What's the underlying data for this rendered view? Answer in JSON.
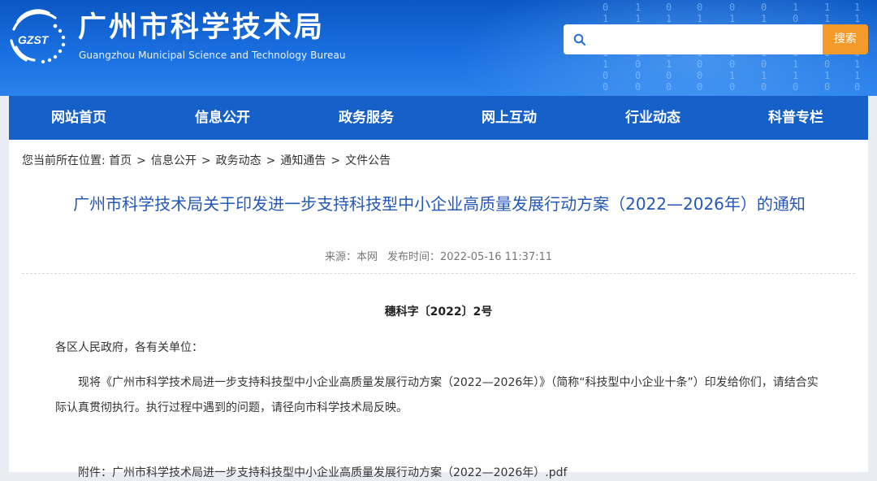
{
  "header": {
    "logo_abbr": "GZST",
    "title": "广州市科学技术局",
    "subtitle": "Guangzhou Municipal Science and Technology Bureau",
    "search": {
      "placeholder": "",
      "value": "",
      "button_label": "搜索",
      "icon": "search-icon"
    },
    "binary_columns": [
      "0\n1\n1\n1\n1\n1\n0\n0",
      "1\n1\n1\n1\n1\n0\n0\n0",
      "0\n1\n1\n1\n1\n1\n0\n0",
      "0\n1\n1\n0\n1\n0\n0\n0",
      "0\n1\n0\n1\n1\n0\n1\n0",
      "0\n1\n1\n0\n1\n0\n1\n0",
      "1\n0\n1\n1\n0\n1\n1\n0",
      "1\n1\n0\n1\n0\n0\n1\n0",
      "1\n1\n1\n0\n0\n1\n1\n0"
    ]
  },
  "nav": {
    "items": [
      {
        "label": "网站首页"
      },
      {
        "label": "信息公开"
      },
      {
        "label": "政务服务"
      },
      {
        "label": "网上互动"
      },
      {
        "label": "行业动态"
      },
      {
        "label": "科普专栏"
      }
    ]
  },
  "breadcrumb": {
    "prefix": "您当前所在位置:",
    "items": [
      "首页",
      "信息公开",
      "政务动态",
      "通知通告",
      "文件公告"
    ],
    "separator": ">"
  },
  "article": {
    "title": "广州市科学技术局关于印发进一步支持科技型中小企业高质量发展行动方案（2022—2026年）的通知",
    "source": "来源：本网",
    "published": "发布时间：2022-05-16 11:37:11",
    "doc_number": "穗科字〔2022〕2号",
    "salutation": "各区人民政府，各有关单位：",
    "body": "现将《广州市科学技术局进一步支持科技型中小企业高质量发展行动方案（2022—2026年）》（简称“科技型中小企业十条”）印发给你们，请结合实际认真贯彻执行。执行过程中遇到的问题，请径向市科学技术局反映。",
    "attachment": "附件：广州市科学技术局进一步支持科技型中小企业高质量发展行动方案（2022—2026年）.pdf"
  },
  "colors": {
    "header_bg": "#1a6fe0",
    "nav_bg": "#1560c9",
    "title_color": "#2458b8",
    "search_button": "#f39a2b"
  }
}
